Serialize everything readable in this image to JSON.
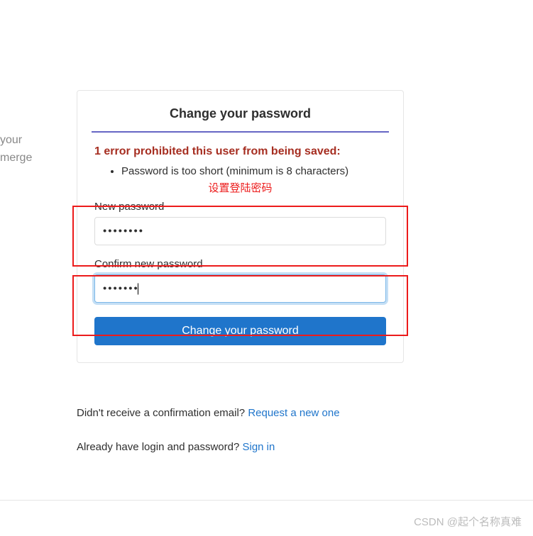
{
  "background": {
    "line1": "your",
    "line2": "merge"
  },
  "card": {
    "title": "Change your password",
    "error_heading": "1 error prohibited this user from being saved:",
    "error_items": [
      "Password is too short (minimum is 8 characters)"
    ],
    "annotation": "设置登陆密码",
    "fields": {
      "new_password": {
        "label": "New password",
        "value": "••••••••"
      },
      "confirm_password": {
        "label": "Confirm new password",
        "value": "•••••••"
      }
    },
    "submit_label": "Change your password"
  },
  "links": {
    "confirmation_text": "Didn't receive a confirmation email? ",
    "confirmation_link": "Request a new one",
    "signin_text": "Already have login and password? ",
    "signin_link": "Sign in"
  },
  "watermark": "CSDN @起个名称真难"
}
